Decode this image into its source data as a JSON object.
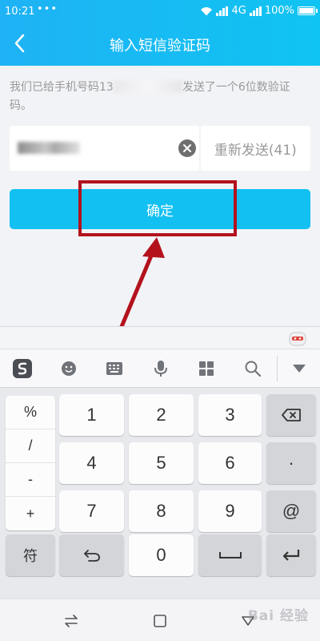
{
  "status_bar": {
    "time": "10:21",
    "dots": "•••",
    "network": "4G",
    "battery": "100%"
  },
  "header": {
    "title": "输入短信验证码"
  },
  "notice": {
    "text_before": "我们已给手机号码13",
    "text_after": "发送了一个6位数验证码。"
  },
  "code_input": {
    "value": "",
    "placeholder": ""
  },
  "resend": {
    "label": "重新发送(41)"
  },
  "confirm": {
    "label": "确定"
  },
  "keyboard": {
    "symbols": [
      "%",
      "/",
      "-",
      "+"
    ],
    "fn_label": "符",
    "digits": [
      "1",
      "2",
      "3",
      "4",
      "5",
      "6",
      "7",
      "8",
      "9",
      "0"
    ],
    "dot": "·",
    "at": "@"
  },
  "watermark": {
    "text": "Bai 经验"
  },
  "colors": {
    "accent": "#12c0f1",
    "highlight": "#b3121d"
  }
}
